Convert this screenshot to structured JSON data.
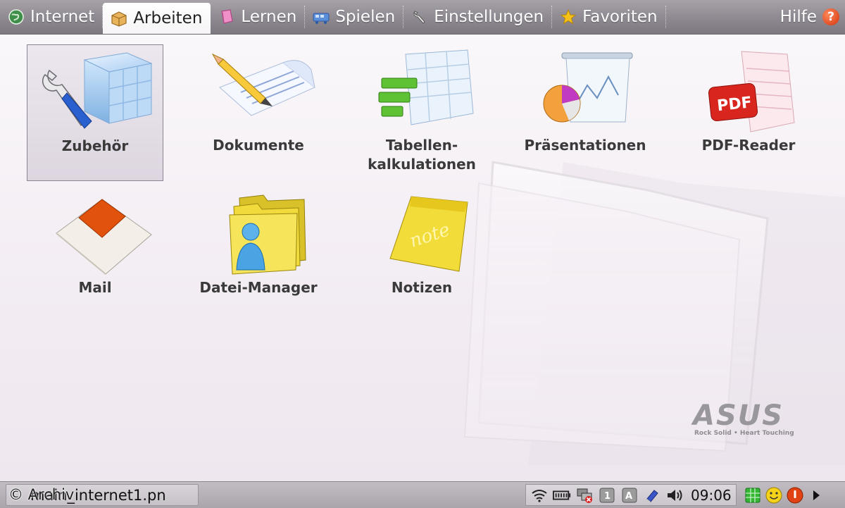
{
  "tabs": [
    {
      "label": "Internet",
      "icon": "globe-icon"
    },
    {
      "label": "Arbeiten",
      "icon": "briefcase-icon",
      "active": true
    },
    {
      "label": "Lernen",
      "icon": "book-icon"
    },
    {
      "label": "Spielen",
      "icon": "game-icon"
    },
    {
      "label": "Einstellungen",
      "icon": "wrench-icon"
    },
    {
      "label": "Favoriten",
      "icon": "star-icon"
    }
  ],
  "help": {
    "label": "Hilfe",
    "badge": "?"
  },
  "apps": [
    {
      "label": "Zubehör",
      "icon": "tools-cube-icon",
      "selected": true
    },
    {
      "label": "Dokumente",
      "icon": "document-pencil-icon"
    },
    {
      "label": "Tabellen-\nkalkulationen",
      "icon": "spreadsheet-icon"
    },
    {
      "label": "Präsentationen",
      "icon": "presentation-icon"
    },
    {
      "label": "PDF-Reader",
      "icon": "pdf-icon"
    },
    {
      "label": "Mail",
      "icon": "envelope-icon"
    },
    {
      "label": "Datei-Manager",
      "icon": "folder-user-icon"
    },
    {
      "label": "Notizen",
      "icon": "note-icon"
    }
  ],
  "brand": {
    "name": "ASUS",
    "tagline": "Rock Solid • Heart Touching"
  },
  "taskbar": {
    "window_title": "main_internet1.pn",
    "watermark": "© Archiv",
    "clock": "09:06"
  },
  "colors": {
    "tab_bar": "#8e8890",
    "active_tab": "#ffffff",
    "help_badge": "#d3320b"
  }
}
